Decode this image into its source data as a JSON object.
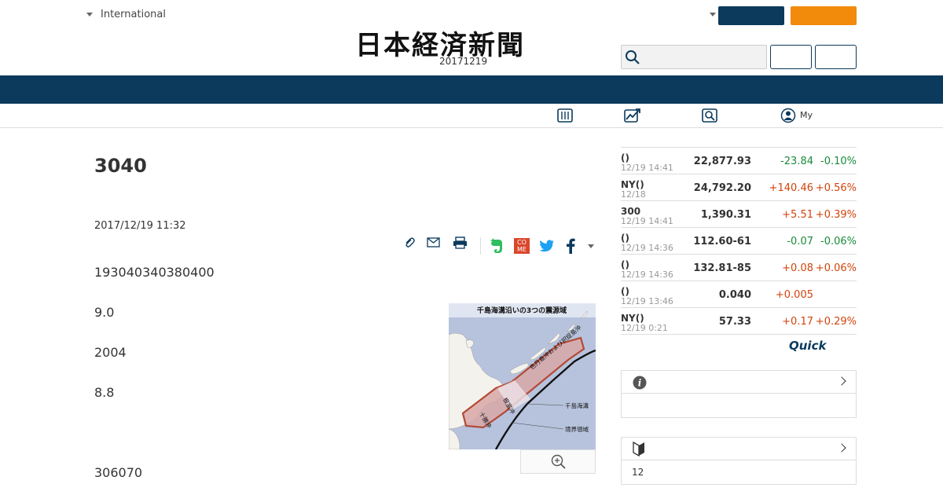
{
  "header": {
    "region_label": "International",
    "logo_text": "日本経済新聞",
    "edition_date": "20171219",
    "my_label": "My"
  },
  "colors": {
    "navy": "#0b3a5d",
    "orange": "#f28a0b",
    "up": "#d1440c",
    "down": "#1a8a3a"
  },
  "article": {
    "title": "3040",
    "date": "2017/12/19 11:32",
    "paragraphs": [
      "193040340380400",
      "9.0",
      "2004",
      "8.8",
      "306070"
    ]
  },
  "figure": {
    "title": "千島海溝沿いの3つの震源域",
    "label_main": "色丹島沖および択捉島沖",
    "label_nemuro": "根室沖",
    "label_tokachi": "十勝沖",
    "label_trench": "千島海溝",
    "label_boundary": "境界領域"
  },
  "market": {
    "rows": [
      {
        "name": "()",
        "time": "12/19 14:41",
        "value": "22,877.93",
        "change": "-23.84",
        "pct": "-0.10%",
        "dir": "down"
      },
      {
        "name": "NY()",
        "time": "12/18",
        "value": "24,792.20",
        "change": "+140.46",
        "pct": "+0.56%",
        "dir": "up"
      },
      {
        "name": "300",
        "time": "12/19 14:41",
        "value": "1,390.31",
        "change": "+5.51",
        "pct": "+0.39%",
        "dir": "up"
      },
      {
        "name": "()",
        "time": "12/19 14:36",
        "value": "112.60-61",
        "change": "-0.07",
        "pct": "-0.06%",
        "dir": "down"
      },
      {
        "name": "()",
        "time": "12/19 14:36",
        "value": "132.81-85",
        "change": "+0.08",
        "pct": "+0.06%",
        "dir": "up"
      },
      {
        "name": "()",
        "time": "12/19 13:46",
        "value": "0.040",
        "change": "+0.005",
        "pct": "",
        "dir": "up"
      },
      {
        "name": "NY()",
        "time": "12/19 0:21",
        "value": "57.33",
        "change": "+0.17",
        "pct": "+0.29%",
        "dir": "up"
      }
    ],
    "provider": "Quick"
  },
  "side": {
    "box2_body": "12"
  }
}
